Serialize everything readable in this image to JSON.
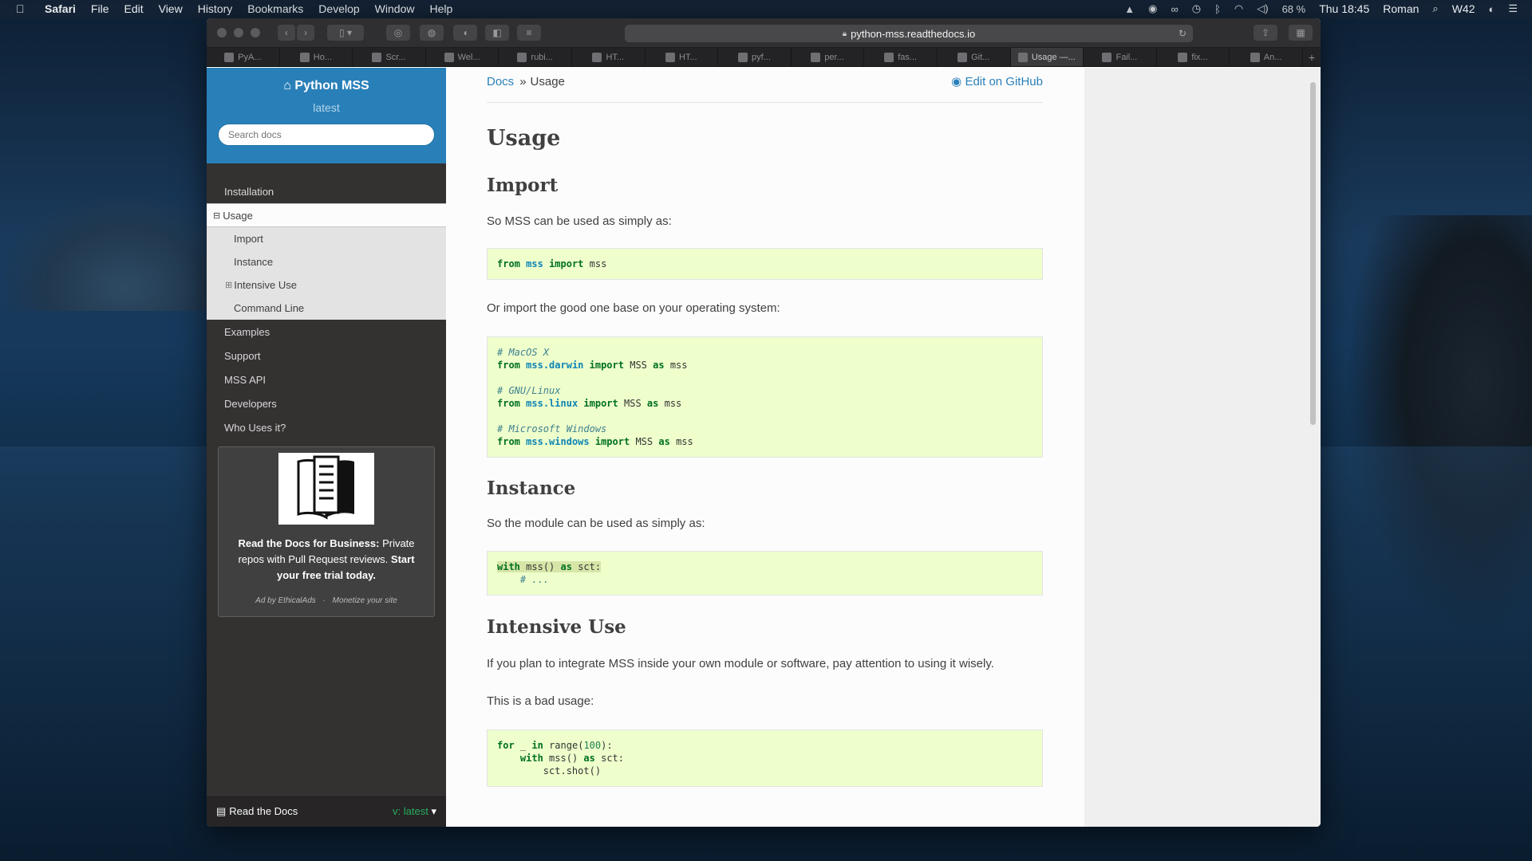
{
  "menubar": {
    "app_name": "Safari",
    "items": [
      "File",
      "Edit",
      "View",
      "History",
      "Bookmarks",
      "Develop",
      "Window",
      "Help"
    ],
    "battery": "68 %",
    "clock": "Thu 18:45",
    "user": "Roman",
    "week": "W42"
  },
  "browser": {
    "url": "python-mss.readthedocs.io",
    "tabs": [
      "PyA...",
      "Ho...",
      "Scr...",
      "Wel...",
      "rubi...",
      "HT...",
      "HT...",
      "pyf...",
      "per...",
      "fas...",
      "Git...",
      "Usage —...",
      "Fail...",
      "fix...",
      "An..."
    ]
  },
  "sidebar": {
    "project": "Python MSS",
    "version": "latest",
    "search_placeholder": "Search docs",
    "nav": {
      "installation": "Installation",
      "usage": "Usage",
      "sub": {
        "import": "Import",
        "instance": "Instance",
        "intensive": "Intensive Use",
        "cli": "Command Line"
      },
      "examples": "Examples",
      "support": "Support",
      "api": "MSS API",
      "developers": "Developers",
      "who": "Who Uses it?"
    },
    "ad": {
      "text_bold1": "Read the Docs for Business:",
      "text_plain": " Private repos with Pull Request reviews. ",
      "text_bold2": "Start your free trial today.",
      "by": "Ad by EthicalAds",
      "dot": "·",
      "monetize": "Monetize your site"
    },
    "footer": {
      "label": "Read the Docs",
      "version": "v: latest"
    }
  },
  "content": {
    "breadcrumb_docs": "Docs",
    "breadcrumb_sep": "»",
    "breadcrumb_current": "Usage",
    "edit_link": "Edit on GitHub",
    "title": "Usage",
    "h_import": "Import",
    "p_import": "So MSS can be used as simply as:",
    "p_import2": "Or import the good one base on your operating system:",
    "h_instance": "Instance",
    "p_instance": "So the module can be used as simply as:",
    "h_intensive": "Intensive Use",
    "p_intensive": "If you plan to integrate MSS inside your own module or software, pay attention to using it wisely.",
    "p_bad": "This is a bad usage:"
  },
  "code": {
    "from": "from",
    "import": "import",
    "as": "as",
    "with": "with",
    "for": "for",
    "in": "in",
    "mss": "mss",
    "MSS": "MSS",
    "mod_darwin": "mss.darwin",
    "mod_linux": "mss.linux",
    "mod_windows": "mss.windows",
    "c_mac": "# MacOS X",
    "c_linux": "# GNU/Linux",
    "c_win": "# Microsoft Windows",
    "c_dots": "# ...",
    "mss_call": "mss()",
    "sct_colon": "sct:",
    "underscore": "_",
    "range_open": "range(",
    "hundred": "100",
    "range_close": "):",
    "shot": "sct.shot()"
  },
  "colors": {
    "rtd_blue": "#2980b9",
    "sidebar_bg": "#343131",
    "code_bg": "#eeffcc",
    "version_green": "#27ae60"
  }
}
